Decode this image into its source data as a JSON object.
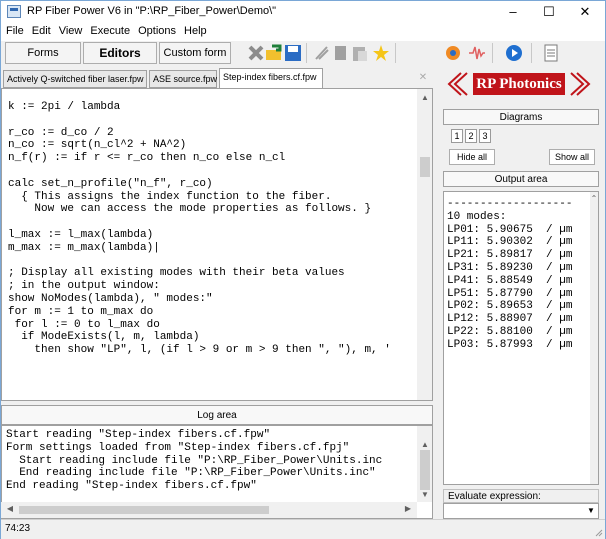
{
  "window": {
    "title": "RP Fiber Power V6 in \"P:\\RP_Fiber_Power\\Demo\\\"",
    "minimize": "–",
    "maximize": "☐",
    "close": "✕"
  },
  "menubar": [
    "File",
    "Edit",
    "View",
    "Execute",
    "Options",
    "Help"
  ],
  "toolbar": {
    "forms_label": "Forms",
    "editors_label": "Editors",
    "custom_form_label": "Custom form"
  },
  "tabs": [
    {
      "label": "Actively Q-switched fiber laser.fpw",
      "active": false
    },
    {
      "label": "ASE source.fpw",
      "active": false
    },
    {
      "label": "Step-index fibers.cf.fpw",
      "active": true
    }
  ],
  "tab_close": "✕",
  "editor": {
    "lines": [
      "k := 2pi / lambda",
      "",
      "r_co := d_co / 2",
      "n_co := sqrt(n_cl^2 + NA^2)",
      "n_f(r) := if r <= r_co then n_co else n_cl",
      "",
      "calc set_n_profile(\"n_f\", r_co)",
      "  { This assigns the index function to the fiber.",
      "    Now we can access the mode properties as follows. }",
      "",
      "l_max := l_max(lambda)",
      "m_max := m_max(lambda)|",
      "",
      "; Display all existing modes with their beta values",
      "; in the output window:",
      "show NoModes(lambda), \" modes:\"",
      "for m := 1 to m_max do",
      " for l := 0 to l_max do",
      "  if ModeExists(l, m, lambda)",
      "    then show \"LP\", l, (if l > 9 or m > 9 then \", \"), m, '"
    ]
  },
  "log": {
    "title": "Log area",
    "lines": [
      "Start reading \"Step-index fibers.cf.fpw\"",
      "Form settings loaded from \"Step-index fibers.cf.fpj\"",
      "  Start reading include file \"P:\\RP_Fiber_Power\\Units.inc",
      "  End reading include file \"P:\\RP_Fiber_Power\\Units.inc\"",
      "End reading \"Step-index fibers.cf.fpw\""
    ]
  },
  "status": {
    "position": "74:23"
  },
  "right_panel": {
    "logo": "RP Photonics",
    "diagrams_title": "Diagrams",
    "diagram_numbers": [
      "1",
      "2",
      "3"
    ],
    "hide_all_label": "Hide all",
    "show_all_label": "Show all",
    "output_title": "Output area",
    "output_lines": [
      "-------------------",
      "10 modes:",
      "LP01: 5.90675  / µm",
      "LP11: 5.90302  / µm",
      "LP21: 5.89817  / µm",
      "LP31: 5.89230  / µm",
      "LP41: 5.88549  / µm",
      "LP51: 5.87790  / µm",
      "LP02: 5.89653  / µm",
      "LP12: 5.88907  / µm",
      "LP22: 5.88100  / µm",
      "LP03: 5.87993  / µm"
    ],
    "evaluate_label": "Evaluate expression:",
    "evaluate_value": ""
  },
  "colors": {
    "brand_red": "#c0141a",
    "accent_blue": "#1f6fd0"
  },
  "icons": [
    "app-icon",
    "scissors-x-icon",
    "open-folder-icon",
    "save-disk-icon",
    "cut-icon",
    "copy-icon",
    "paste-icon",
    "star-icon",
    "circle-target-icon",
    "signal-icon",
    "play-icon",
    "document-icon"
  ]
}
